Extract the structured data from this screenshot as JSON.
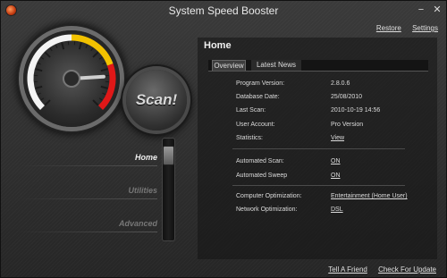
{
  "window": {
    "title": "System Speed Booster",
    "min_glyph": "−",
    "close_glyph": "✕"
  },
  "top_links": {
    "restore": "Restore",
    "settings": "Settings"
  },
  "gauge": {
    "level": 0.82
  },
  "scan_button": "Scan!",
  "nav": {
    "items": [
      {
        "label": "Home"
      },
      {
        "label": "Utilities"
      },
      {
        "label": "Advanced"
      }
    ],
    "active": "Home"
  },
  "panel": {
    "title": "Home",
    "tabs": [
      {
        "label": "Overview",
        "active": true
      },
      {
        "label": "Latest News",
        "active": false
      }
    ],
    "info": {
      "program_version": {
        "label": "Program Version:",
        "value": "2.8.0.6"
      },
      "database_date": {
        "label": "Database Date:",
        "value": "25/08/2010"
      },
      "last_scan": {
        "label": "Last Scan:",
        "value": "2010-10-19 14:56"
      },
      "user_account": {
        "label": "User Account:",
        "value": "Pro Version"
      },
      "statistics": {
        "label": "Statistics:",
        "value": "View"
      },
      "automated_scan": {
        "label": "Automated Scan:",
        "value": "ON"
      },
      "automated_sweep": {
        "label": "Automated Sweep",
        "value": "ON"
      },
      "computer_optimization": {
        "label": "Computer Optimization:",
        "value": "Entertainment (Home User)"
      },
      "network_optimization": {
        "label": "Network Optimization:",
        "value": "DSL"
      }
    }
  },
  "bottom_links": {
    "tell_a_friend": "Tell A Friend",
    "check_for_update": "Check For Update"
  },
  "colors": {
    "gauge_red": "#e01818",
    "gauge_yellow": "#f2c200",
    "gauge_white": "#f4f4f4"
  }
}
